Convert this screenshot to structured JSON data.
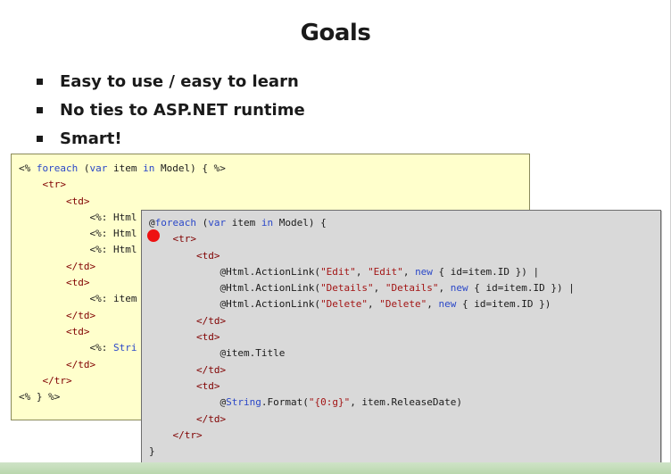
{
  "slide": {
    "title": "Goals",
    "bullets": [
      "Easy to use / easy to learn",
      "No ties to ASP.NET runtime",
      "Smart!"
    ]
  },
  "webforms_code": [
    [
      {
        "t": "<%",
        "c": "plain"
      },
      {
        "t": " foreach ",
        "c": "kw"
      },
      {
        "t": "(",
        "c": "plain"
      },
      {
        "t": "var",
        "c": "kw"
      },
      {
        "t": " item ",
        "c": "plain"
      },
      {
        "t": "in",
        "c": "kw"
      },
      {
        "t": " Model) { %>",
        "c": "plain"
      }
    ],
    [
      {
        "t": "    ",
        "c": "plain"
      },
      {
        "t": "<tr>",
        "c": "tag"
      }
    ],
    [
      {
        "t": "        ",
        "c": "plain"
      },
      {
        "t": "<td>",
        "c": "tag"
      }
    ],
    [
      {
        "t": "            <%: Html",
        "c": "plain"
      }
    ],
    [
      {
        "t": "            <%: Html",
        "c": "plain"
      }
    ],
    [
      {
        "t": "            <%: Html",
        "c": "plain"
      }
    ],
    [
      {
        "t": "        ",
        "c": "plain"
      },
      {
        "t": "</td>",
        "c": "tag"
      }
    ],
    [
      {
        "t": "        ",
        "c": "plain"
      },
      {
        "t": "<td>",
        "c": "tag"
      }
    ],
    [
      {
        "t": "            <%: item",
        "c": "plain"
      }
    ],
    [
      {
        "t": "        ",
        "c": "plain"
      },
      {
        "t": "</td>",
        "c": "tag"
      }
    ],
    [
      {
        "t": "        ",
        "c": "plain"
      },
      {
        "t": "<td>",
        "c": "tag"
      }
    ],
    [
      {
        "t": "            <%: ",
        "c": "plain"
      },
      {
        "t": "Stri",
        "c": "kw"
      }
    ],
    [
      {
        "t": "        ",
        "c": "plain"
      },
      {
        "t": "</td>",
        "c": "tag"
      }
    ],
    [
      {
        "t": "    ",
        "c": "plain"
      },
      {
        "t": "</tr>",
        "c": "tag"
      }
    ],
    [
      {
        "t": "<% } %>",
        "c": "plain"
      }
    ]
  ],
  "razor_code": [
    [
      {
        "t": "@",
        "c": "plain"
      },
      {
        "t": "foreach",
        "c": "kw"
      },
      {
        "t": " (",
        "c": "plain"
      },
      {
        "t": "var",
        "c": "kw"
      },
      {
        "t": " item ",
        "c": "plain"
      },
      {
        "t": "in",
        "c": "kw"
      },
      {
        "t": " Model) {",
        "c": "plain"
      }
    ],
    [
      {
        "t": "    ",
        "c": "plain"
      },
      {
        "t": "<tr>",
        "c": "tag"
      }
    ],
    [
      {
        "t": "        ",
        "c": "plain"
      },
      {
        "t": "<td>",
        "c": "tag"
      }
    ],
    [
      {
        "t": "            @Html.ActionLink(",
        "c": "plain"
      },
      {
        "t": "\"Edit\"",
        "c": "str"
      },
      {
        "t": ", ",
        "c": "plain"
      },
      {
        "t": "\"Edit\"",
        "c": "str"
      },
      {
        "t": ", ",
        "c": "plain"
      },
      {
        "t": "new",
        "c": "kw"
      },
      {
        "t": " { id=item.ID }) |",
        "c": "plain"
      }
    ],
    [
      {
        "t": "            @Html.ActionLink(",
        "c": "plain"
      },
      {
        "t": "\"Details\"",
        "c": "str"
      },
      {
        "t": ", ",
        "c": "plain"
      },
      {
        "t": "\"Details\"",
        "c": "str"
      },
      {
        "t": ", ",
        "c": "plain"
      },
      {
        "t": "new",
        "c": "kw"
      },
      {
        "t": " { id=item.ID }) |",
        "c": "plain"
      }
    ],
    [
      {
        "t": "            @Html.ActionLink(",
        "c": "plain"
      },
      {
        "t": "\"Delete\"",
        "c": "str"
      },
      {
        "t": ", ",
        "c": "plain"
      },
      {
        "t": "\"Delete\"",
        "c": "str"
      },
      {
        "t": ", ",
        "c": "plain"
      },
      {
        "t": "new",
        "c": "kw"
      },
      {
        "t": " { id=item.ID })",
        "c": "plain"
      }
    ],
    [
      {
        "t": "        ",
        "c": "plain"
      },
      {
        "t": "</td>",
        "c": "tag"
      }
    ],
    [
      {
        "t": "        ",
        "c": "plain"
      },
      {
        "t": "<td>",
        "c": "tag"
      }
    ],
    [
      {
        "t": "            @item.Title",
        "c": "plain"
      }
    ],
    [
      {
        "t": "        ",
        "c": "plain"
      },
      {
        "t": "</td>",
        "c": "tag"
      }
    ],
    [
      {
        "t": "        ",
        "c": "plain"
      },
      {
        "t": "<td>",
        "c": "tag"
      }
    ],
    [
      {
        "t": "            @",
        "c": "plain"
      },
      {
        "t": "String",
        "c": "kw"
      },
      {
        "t": ".Format(",
        "c": "plain"
      },
      {
        "t": "\"{0:g}\"",
        "c": "str"
      },
      {
        "t": ", item.ReleaseDate)",
        "c": "plain"
      }
    ],
    [
      {
        "t": "        ",
        "c": "plain"
      },
      {
        "t": "</td>",
        "c": "tag"
      }
    ],
    [
      {
        "t": "    ",
        "c": "plain"
      },
      {
        "t": "</tr>",
        "c": "tag"
      }
    ],
    [
      {
        "t": "}",
        "c": "plain"
      }
    ]
  ],
  "colors": {
    "keyword": "#2b48c8",
    "string": "#a31515",
    "tag": "#800000",
    "breakpoint": "#ee1111",
    "webforms_bg": "#ffffcc",
    "razor_bg": "#d9d9d9"
  },
  "icons": {
    "breakpoint": "breakpoint-dot-icon",
    "bullet": "square-bullet-icon"
  }
}
